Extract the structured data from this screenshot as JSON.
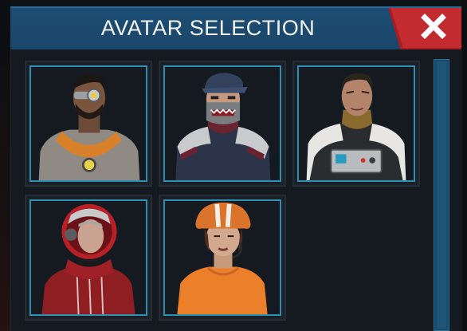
{
  "window": {
    "title": "AVATAR SELECTION",
    "close_icon": "close-x-icon"
  },
  "colors": {
    "header": "#1b4a6f",
    "close_button": "#b5262b",
    "slot_border": "#2e8fb3",
    "scrollbar": "#1a4a6a"
  },
  "avatars": [
    {
      "icon": "avatar-goggles-man-icon"
    },
    {
      "icon": "avatar-masked-soldier-icon"
    },
    {
      "icon": "avatar-pilot-man-icon"
    },
    {
      "icon": "avatar-helmet-woman-icon"
    },
    {
      "icon": "avatar-orange-helmet-woman-icon"
    }
  ]
}
